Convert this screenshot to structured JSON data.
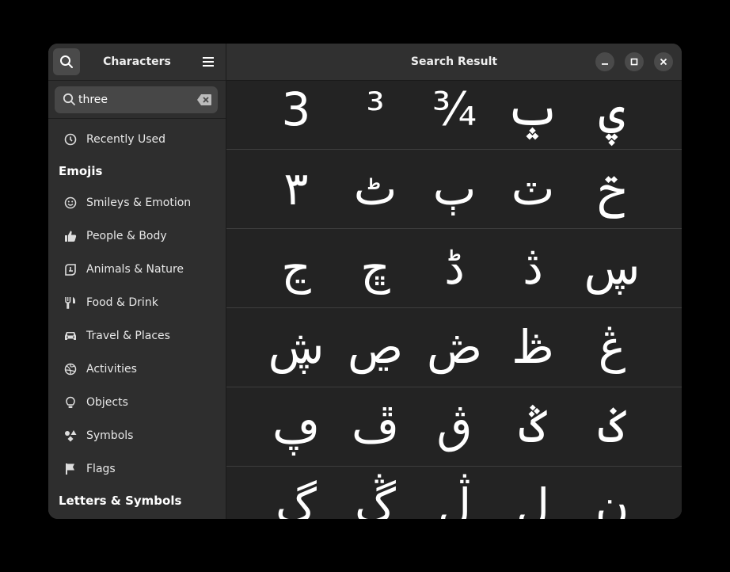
{
  "sidebar": {
    "title": "Characters",
    "search": {
      "value": "three",
      "placeholder": ""
    },
    "recently_used": "Recently Used",
    "emojis_header": "Emojis",
    "emoji_items": [
      "Smileys & Emotion",
      "People & Body",
      "Animals & Nature",
      "Food & Drink",
      "Travel & Places",
      "Activities",
      "Objects",
      "Symbols",
      "Flags"
    ],
    "letters_header": "Letters & Symbols"
  },
  "header": {
    "title": "Search Result"
  },
  "results": [
    [
      "3",
      "³",
      "¾",
      "ݒ",
      "ۑ"
    ],
    [
      "٣",
      "ٹ",
      "ٻ",
      "ٽ",
      "ݗ"
    ],
    [
      "ڃ",
      "ڇ",
      "ڈ",
      "ڎ",
      "ڛ"
    ],
    [
      "ڜ",
      "ڝ",
      "ڞ",
      "ڟ",
      "ڠ"
    ],
    [
      "ڥ",
      "ڦ",
      "ڨ",
      "ݣ",
      "ݢ"
    ],
    [
      "ڳ",
      "ڴ",
      "ڷ",
      "ڸ",
      "ڹ"
    ]
  ]
}
